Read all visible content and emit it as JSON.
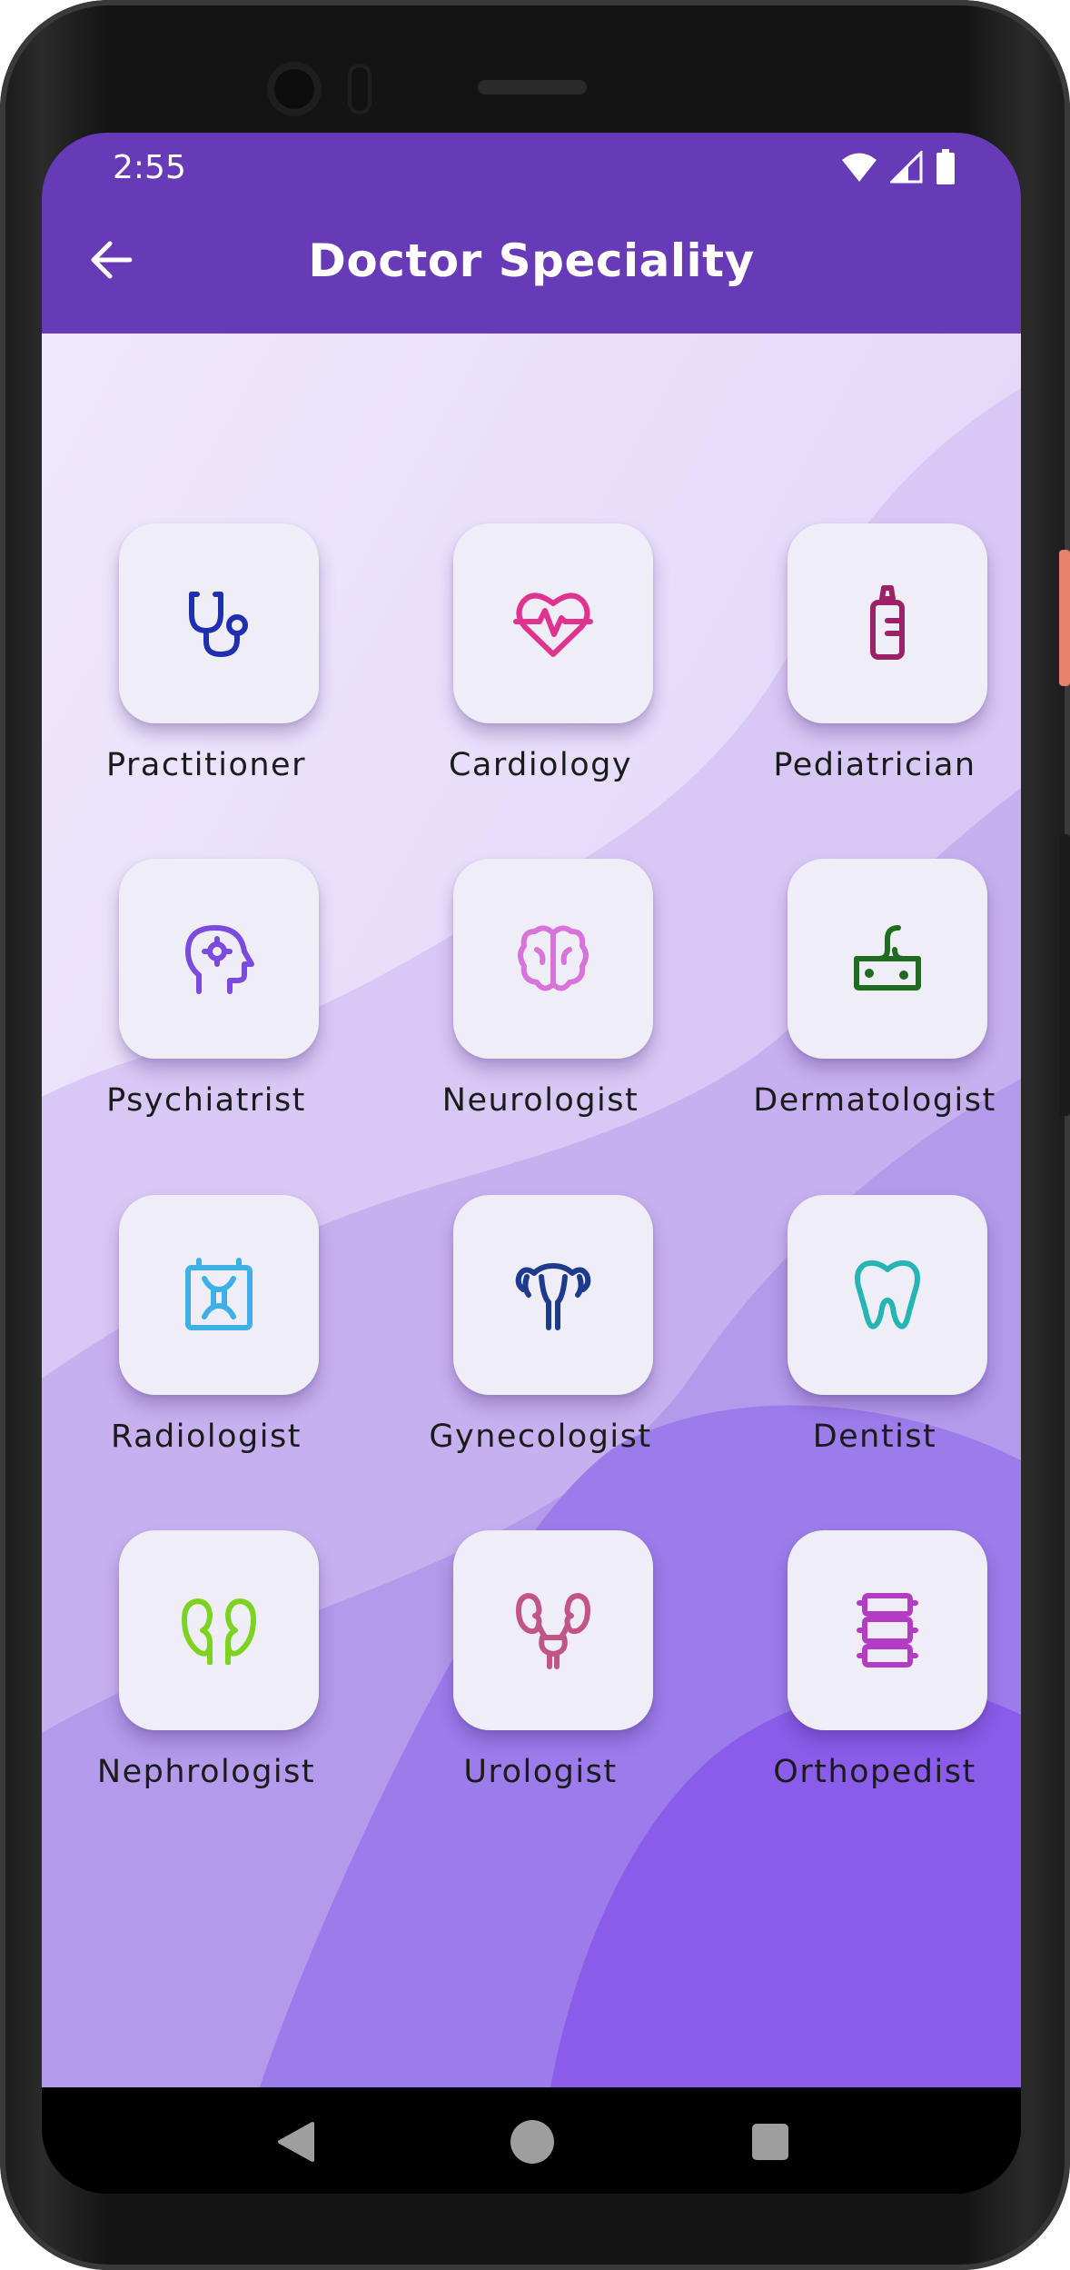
{
  "status_bar": {
    "time": "2:55",
    "icons": [
      "wifi-icon",
      "signal-icon",
      "battery-icon"
    ]
  },
  "app_bar": {
    "title": "Doctor Speciality",
    "back_icon": "arrow-left-icon",
    "background_color": "#673ab7"
  },
  "specialities": [
    {
      "label": "Practitioner",
      "icon": "stethoscope-icon",
      "color": "#1f2fb0"
    },
    {
      "label": "Cardiology",
      "icon": "heart-pulse-icon",
      "color": "#e0328f"
    },
    {
      "label": "Pediatrician",
      "icon": "baby-bottle-icon",
      "color": "#9c2266"
    },
    {
      "label": "Psychiatrist",
      "icon": "head-gear-icon",
      "color": "#7b4be0"
    },
    {
      "label": "Neurologist",
      "icon": "brain-icon",
      "color": "#d873db"
    },
    {
      "label": "Dermatologist",
      "icon": "skin-icon",
      "color": "#1e6b21"
    },
    {
      "label": "Radiologist",
      "icon": "xray-icon",
      "color": "#3fb0e6"
    },
    {
      "label": "Gynecologist",
      "icon": "uterus-icon",
      "color": "#1d3a8f"
    },
    {
      "label": "Dentist",
      "icon": "tooth-icon",
      "color": "#25b5b5"
    },
    {
      "label": "Nephrologist",
      "icon": "kidneys-icon",
      "color": "#7ed321"
    },
    {
      "label": "Urologist",
      "icon": "bladder-icon",
      "color": "#c25588"
    },
    {
      "label": "Orthopedist",
      "icon": "spine-icon",
      "color": "#b43cc4"
    }
  ],
  "nav_bar": {
    "icons": [
      "back-triangle-icon",
      "home-circle-icon",
      "recents-square-icon"
    ]
  }
}
